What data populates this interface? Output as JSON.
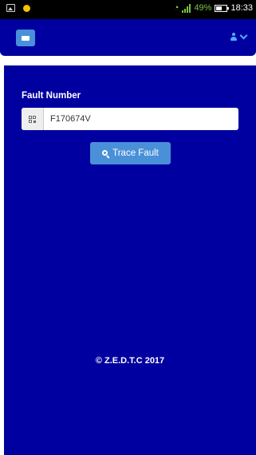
{
  "status_bar": {
    "battery": "49%",
    "time": "18:33",
    "icons": [
      "image-icon",
      "app-notification-icon",
      "wifi-icon",
      "signal-icon",
      "battery-icon"
    ]
  },
  "navbar": {
    "menu_icon": "menu-icon",
    "user_icon": "user-icon",
    "chevron_icon": "chevron-down-icon",
    "colors": {
      "bar": "#0000a0",
      "button": "#4a90d9",
      "user": "#58a8ff"
    }
  },
  "form": {
    "label": "Fault Number",
    "input_value": "F170674V",
    "addon_icon": "qr-code-icon",
    "button_label": "Trace Fault",
    "button_icon": "search-icon"
  },
  "footer": {
    "text": "© Z.E.D.T.C  2017"
  },
  "colors": {
    "background": "#0000a0",
    "accent": "#4a90d9"
  }
}
